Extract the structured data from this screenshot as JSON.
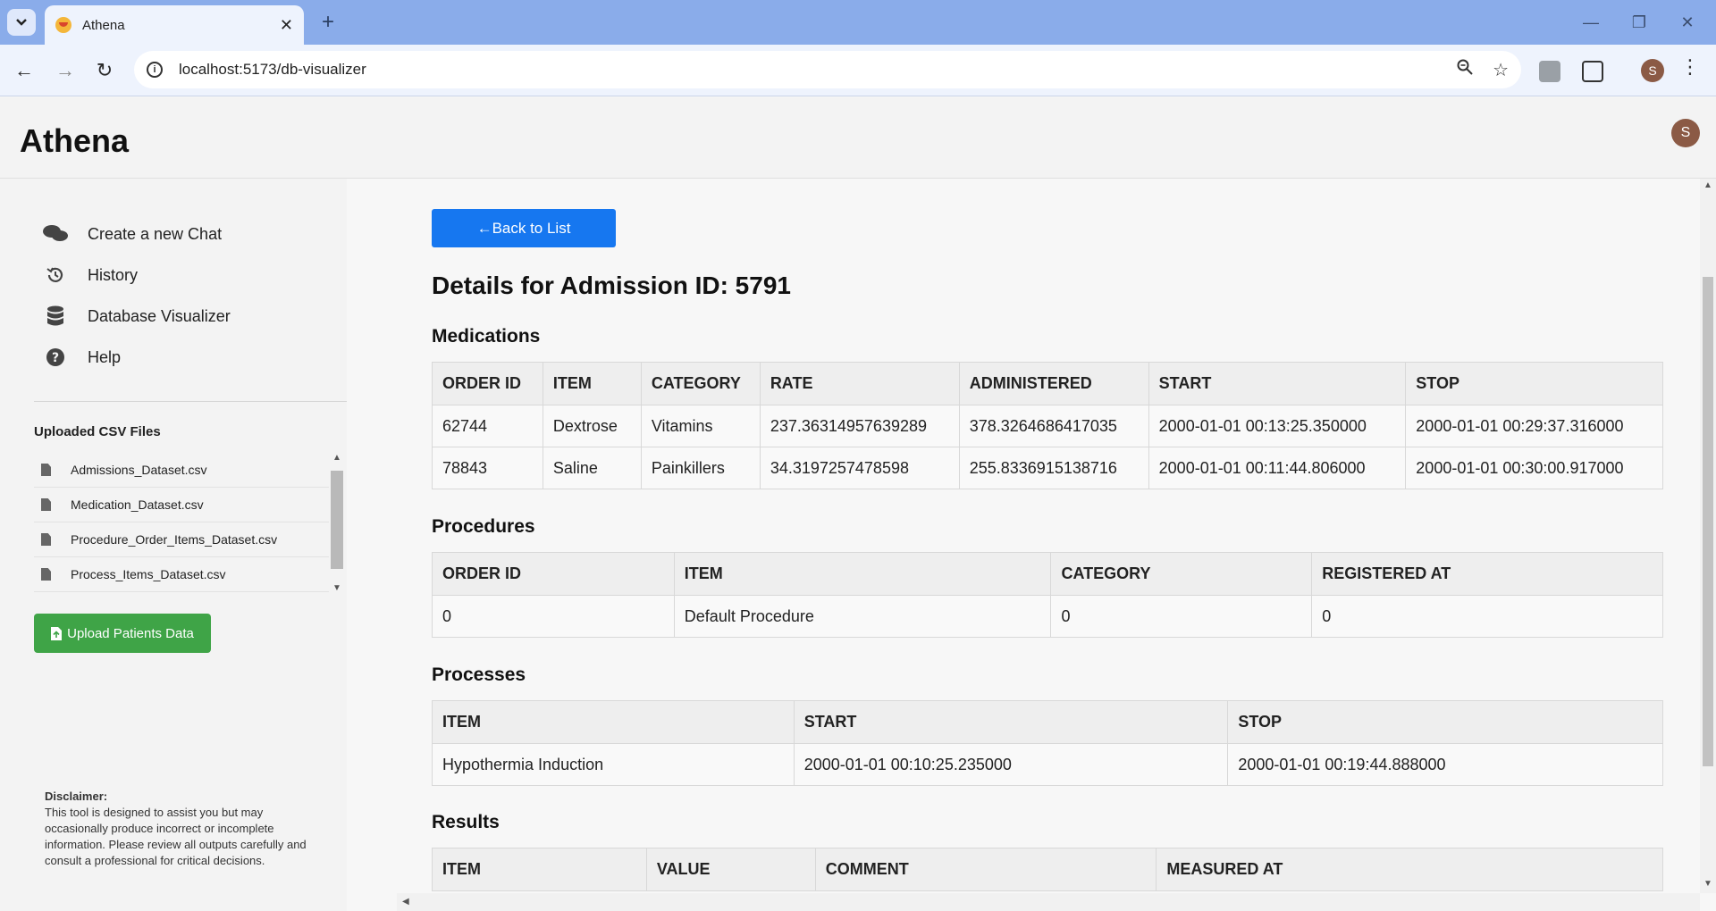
{
  "browser": {
    "tab_title": "Athena",
    "url": "localhost:5173/db-visualizer",
    "profile_initial": "S"
  },
  "app": {
    "logo": "Athena",
    "avatar_initial": "S"
  },
  "sidebar": {
    "nav": [
      {
        "label": "Create a new Chat",
        "icon": "chat-icon"
      },
      {
        "label": "History",
        "icon": "history-icon"
      },
      {
        "label": "Database Visualizer",
        "icon": "database-icon"
      },
      {
        "label": "Help",
        "icon": "help-icon"
      }
    ],
    "csv_title": "Uploaded CSV Files",
    "csv_files": [
      "Admissions_Dataset.csv",
      "Medication_Dataset.csv",
      "Procedure_Order_Items_Dataset.csv",
      "Process_Items_Dataset.csv"
    ],
    "upload_label": "Upload Patients Data",
    "disclaimer_label": "Disclaimer:",
    "disclaimer_text": "This tool is designed to assist you but may occasionally produce incorrect or incomplete information. Please review all outputs carefully and consult a professional for critical decisions."
  },
  "main": {
    "back_label": "←Back to List",
    "title": "Details for Admission ID: 5791",
    "medications": {
      "title": "Medications",
      "columns": [
        "ORDER ID",
        "ITEM",
        "CATEGORY",
        "RATE",
        "ADMINISTERED",
        "START",
        "STOP"
      ],
      "rows": [
        [
          "62744",
          "Dextrose",
          "Vitamins",
          "237.36314957639289",
          "378.3264686417035",
          "2000-01-01 00:13:25.350000",
          "2000-01-01 00:29:37.316000"
        ],
        [
          "78843",
          "Saline",
          "Painkillers",
          "34.3197257478598",
          "255.8336915138716",
          "2000-01-01 00:11:44.806000",
          "2000-01-01 00:30:00.917000"
        ]
      ]
    },
    "procedures": {
      "title": "Procedures",
      "columns": [
        "ORDER ID",
        "ITEM",
        "CATEGORY",
        "REGISTERED AT"
      ],
      "rows": [
        [
          "0",
          "Default Procedure",
          "0",
          "0"
        ]
      ]
    },
    "processes": {
      "title": "Processes",
      "columns": [
        "ITEM",
        "START",
        "STOP"
      ],
      "rows": [
        [
          "Hypothermia Induction",
          "2000-01-01 00:10:25.235000",
          "2000-01-01 00:19:44.888000"
        ]
      ]
    },
    "results": {
      "title": "Results",
      "columns": [
        "ITEM",
        "VALUE",
        "COMMENT",
        "MEASURED AT"
      ]
    }
  },
  "colors": {
    "back_button": "#1677f0",
    "upload_button": "#3fa447",
    "tabstrip": "#8aacea"
  }
}
